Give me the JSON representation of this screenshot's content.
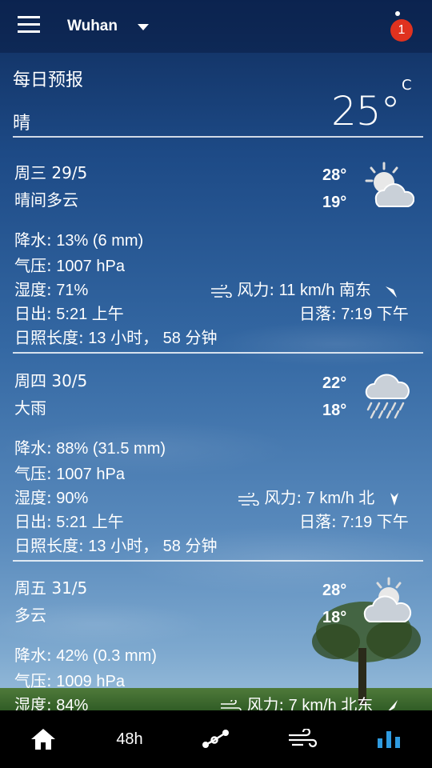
{
  "topbar": {
    "city": "Wuhan",
    "alert_count": "1"
  },
  "header": {
    "title": "每日预报",
    "condition": "晴",
    "temp": "25°",
    "unit": "C"
  },
  "days": [
    {
      "date": "周三 29/5",
      "condition": "晴间多云",
      "high": "28°",
      "low": "19°",
      "icon": "partly-cloudy-icon",
      "precip_label": "降水:",
      "precip_value": " 13% (6 mm)",
      "pressure_label": "气压:",
      "pressure_value": " 1007 hPa",
      "humidity_label": "湿度:",
      "humidity_value": " 71%",
      "wind_label": "风力:",
      "wind_value": " 11 km/h 南东",
      "sunrise_label": "日出:",
      "sunrise_value": " 5:21 上午",
      "sunset_label": "日落:",
      "sunset_value": " 7:19 下午",
      "daylight_label": "日照长度:",
      "daylight_value": " 13 小时， 58 分钟"
    },
    {
      "date": "周四 30/5",
      "condition": "大雨",
      "high": "22°",
      "low": "18°",
      "icon": "heavy-rain-icon",
      "precip_label": "降水:",
      "precip_value": " 88% (31.5 mm)",
      "pressure_label": "气压:",
      "pressure_value": " 1007 hPa",
      "humidity_label": "湿度:",
      "humidity_value": " 90%",
      "wind_label": "风力:",
      "wind_value": " 7 km/h 北",
      "sunrise_label": "日出:",
      "sunrise_value": " 5:21 上午",
      "sunset_label": "日落:",
      "sunset_value": " 7:19 下午",
      "daylight_label": "日照长度:",
      "daylight_value": " 13 小时， 58 分钟"
    },
    {
      "date": "周五 31/5",
      "condition": "多云",
      "high": "28°",
      "low": "18°",
      "icon": "cloudy-icon",
      "precip_label": "降水:",
      "precip_value": " 42% (0.3 mm)",
      "pressure_label": "气压:",
      "pressure_value": " 1009 hPa",
      "humidity_label": "湿度:",
      "humidity_value": " 84%",
      "wind_label": "风力:",
      "wind_value": " 7 km/h 北东"
    }
  ],
  "bottom_nav": {
    "hourly_label": "48h"
  },
  "colors": {
    "badge": "#e0321f",
    "active_nav": "#2f9be0"
  }
}
